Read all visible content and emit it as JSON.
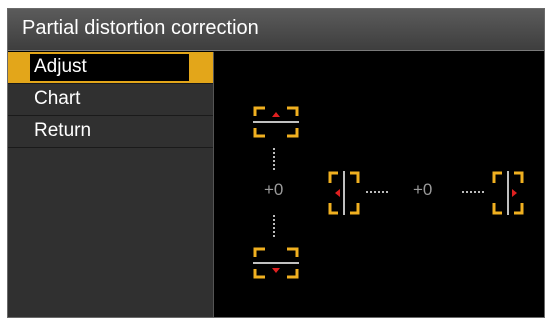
{
  "title": "Partial distortion correction",
  "menu": {
    "items": [
      {
        "label": "Adjust",
        "selected": true
      },
      {
        "label": "Chart",
        "selected": false
      },
      {
        "label": "Return",
        "selected": false
      }
    ]
  },
  "adjust": {
    "vertical_value": "+0",
    "horizontal_value": "+0"
  },
  "colors": {
    "accent": "#e3a61a",
    "arrow": "#e02020",
    "bracket": "#f0b020"
  }
}
